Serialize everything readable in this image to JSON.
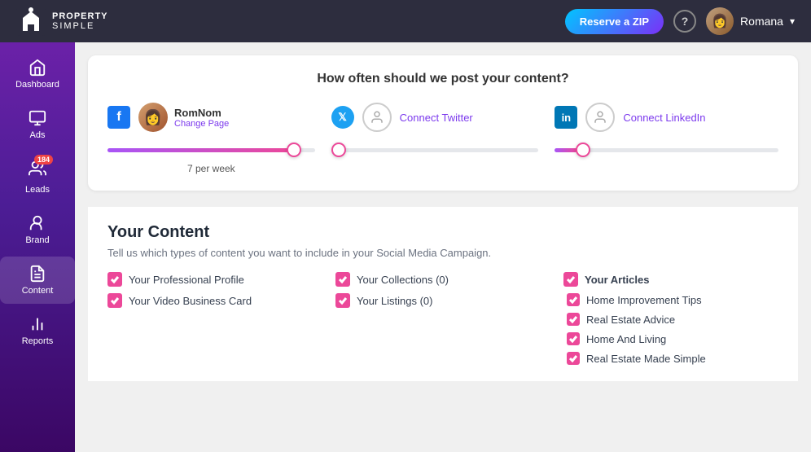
{
  "header": {
    "logo_text_part1": "PROPERTY",
    "logo_text_part2": "SIMPLE",
    "reserve_btn": "Reserve a ZIP",
    "user_name": "Romana"
  },
  "sidebar": {
    "items": [
      {
        "id": "dashboard",
        "label": "Dashboard",
        "active": false
      },
      {
        "id": "ads",
        "label": "Ads",
        "active": false
      },
      {
        "id": "leads",
        "label": "Leads",
        "active": false,
        "badge": "184"
      },
      {
        "id": "brand",
        "label": "Brand",
        "active": false
      },
      {
        "id": "content",
        "label": "Content",
        "active": true
      },
      {
        "id": "reports",
        "label": "Reports",
        "active": false
      }
    ]
  },
  "post_frequency": {
    "title": "How often should we post your content?",
    "facebook": {
      "user_name": "RomNom",
      "change_page": "Change Page",
      "slider_value": "7 per week",
      "fill_percent": 90
    },
    "twitter": {
      "connect_text": "Connect Twitter",
      "fill_percent": 0
    },
    "linkedin": {
      "connect_text": "Connect LinkedIn",
      "fill_percent": 10
    }
  },
  "your_content": {
    "title": "Your Content",
    "subtitle": "Tell us which types of content you want to include in your Social Media Campaign.",
    "items_col1": [
      {
        "label": "Your Professional Profile",
        "checked": true
      },
      {
        "label": "Your Video Business Card",
        "checked": true
      }
    ],
    "items_col2": [
      {
        "label": "Your Collections (0)",
        "checked": true
      },
      {
        "label": "Your Listings (0)",
        "checked": true
      }
    ],
    "col3_header": "Your Articles",
    "articles": [
      {
        "label": "Home Improvement Tips",
        "checked": true
      },
      {
        "label": "Real Estate Advice",
        "checked": true
      },
      {
        "label": "Home And Living",
        "checked": true
      },
      {
        "label": "Real Estate Made Simple",
        "checked": true
      }
    ]
  }
}
